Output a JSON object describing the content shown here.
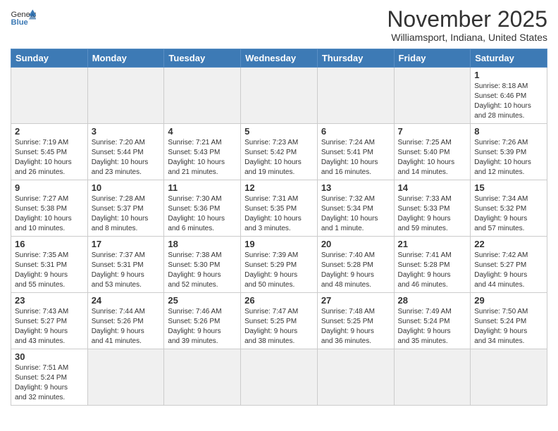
{
  "header": {
    "logo_general": "General",
    "logo_blue": "Blue",
    "month_title": "November 2025",
    "location": "Williamsport, Indiana, United States"
  },
  "weekdays": [
    "Sunday",
    "Monday",
    "Tuesday",
    "Wednesday",
    "Thursday",
    "Friday",
    "Saturday"
  ],
  "weeks": [
    [
      {
        "day": "",
        "empty": true
      },
      {
        "day": "",
        "empty": true
      },
      {
        "day": "",
        "empty": true
      },
      {
        "day": "",
        "empty": true
      },
      {
        "day": "",
        "empty": true
      },
      {
        "day": "",
        "empty": true
      },
      {
        "day": "1",
        "info": "Sunrise: 8:18 AM\nSunset: 6:46 PM\nDaylight: 10 hours\nand 28 minutes."
      }
    ],
    [
      {
        "day": "2",
        "info": "Sunrise: 7:19 AM\nSunset: 5:45 PM\nDaylight: 10 hours\nand 26 minutes."
      },
      {
        "day": "3",
        "info": "Sunrise: 7:20 AM\nSunset: 5:44 PM\nDaylight: 10 hours\nand 23 minutes."
      },
      {
        "day": "4",
        "info": "Sunrise: 7:21 AM\nSunset: 5:43 PM\nDaylight: 10 hours\nand 21 minutes."
      },
      {
        "day": "5",
        "info": "Sunrise: 7:23 AM\nSunset: 5:42 PM\nDaylight: 10 hours\nand 19 minutes."
      },
      {
        "day": "6",
        "info": "Sunrise: 7:24 AM\nSunset: 5:41 PM\nDaylight: 10 hours\nand 16 minutes."
      },
      {
        "day": "7",
        "info": "Sunrise: 7:25 AM\nSunset: 5:40 PM\nDaylight: 10 hours\nand 14 minutes."
      },
      {
        "day": "8",
        "info": "Sunrise: 7:26 AM\nSunset: 5:39 PM\nDaylight: 10 hours\nand 12 minutes."
      }
    ],
    [
      {
        "day": "9",
        "info": "Sunrise: 7:27 AM\nSunset: 5:38 PM\nDaylight: 10 hours\nand 10 minutes."
      },
      {
        "day": "10",
        "info": "Sunrise: 7:28 AM\nSunset: 5:37 PM\nDaylight: 10 hours\nand 8 minutes."
      },
      {
        "day": "11",
        "info": "Sunrise: 7:30 AM\nSunset: 5:36 PM\nDaylight: 10 hours\nand 6 minutes."
      },
      {
        "day": "12",
        "info": "Sunrise: 7:31 AM\nSunset: 5:35 PM\nDaylight: 10 hours\nand 3 minutes."
      },
      {
        "day": "13",
        "info": "Sunrise: 7:32 AM\nSunset: 5:34 PM\nDaylight: 10 hours\nand 1 minute."
      },
      {
        "day": "14",
        "info": "Sunrise: 7:33 AM\nSunset: 5:33 PM\nDaylight: 9 hours\nand 59 minutes."
      },
      {
        "day": "15",
        "info": "Sunrise: 7:34 AM\nSunset: 5:32 PM\nDaylight: 9 hours\nand 57 minutes."
      }
    ],
    [
      {
        "day": "16",
        "info": "Sunrise: 7:35 AM\nSunset: 5:31 PM\nDaylight: 9 hours\nand 55 minutes."
      },
      {
        "day": "17",
        "info": "Sunrise: 7:37 AM\nSunset: 5:31 PM\nDaylight: 9 hours\nand 53 minutes."
      },
      {
        "day": "18",
        "info": "Sunrise: 7:38 AM\nSunset: 5:30 PM\nDaylight: 9 hours\nand 52 minutes."
      },
      {
        "day": "19",
        "info": "Sunrise: 7:39 AM\nSunset: 5:29 PM\nDaylight: 9 hours\nand 50 minutes."
      },
      {
        "day": "20",
        "info": "Sunrise: 7:40 AM\nSunset: 5:28 PM\nDaylight: 9 hours\nand 48 minutes."
      },
      {
        "day": "21",
        "info": "Sunrise: 7:41 AM\nSunset: 5:28 PM\nDaylight: 9 hours\nand 46 minutes."
      },
      {
        "day": "22",
        "info": "Sunrise: 7:42 AM\nSunset: 5:27 PM\nDaylight: 9 hours\nand 44 minutes."
      }
    ],
    [
      {
        "day": "23",
        "info": "Sunrise: 7:43 AM\nSunset: 5:27 PM\nDaylight: 9 hours\nand 43 minutes."
      },
      {
        "day": "24",
        "info": "Sunrise: 7:44 AM\nSunset: 5:26 PM\nDaylight: 9 hours\nand 41 minutes."
      },
      {
        "day": "25",
        "info": "Sunrise: 7:46 AM\nSunset: 5:26 PM\nDaylight: 9 hours\nand 39 minutes."
      },
      {
        "day": "26",
        "info": "Sunrise: 7:47 AM\nSunset: 5:25 PM\nDaylight: 9 hours\nand 38 minutes."
      },
      {
        "day": "27",
        "info": "Sunrise: 7:48 AM\nSunset: 5:25 PM\nDaylight: 9 hours\nand 36 minutes."
      },
      {
        "day": "28",
        "info": "Sunrise: 7:49 AM\nSunset: 5:24 PM\nDaylight: 9 hours\nand 35 minutes."
      },
      {
        "day": "29",
        "info": "Sunrise: 7:50 AM\nSunset: 5:24 PM\nDaylight: 9 hours\nand 34 minutes."
      }
    ],
    [
      {
        "day": "30",
        "info": "Sunrise: 7:51 AM\nSunset: 5:24 PM\nDaylight: 9 hours\nand 32 minutes."
      },
      {
        "day": "",
        "empty": true
      },
      {
        "day": "",
        "empty": true
      },
      {
        "day": "",
        "empty": true
      },
      {
        "day": "",
        "empty": true
      },
      {
        "day": "",
        "empty": true
      },
      {
        "day": "",
        "empty": true
      }
    ]
  ]
}
